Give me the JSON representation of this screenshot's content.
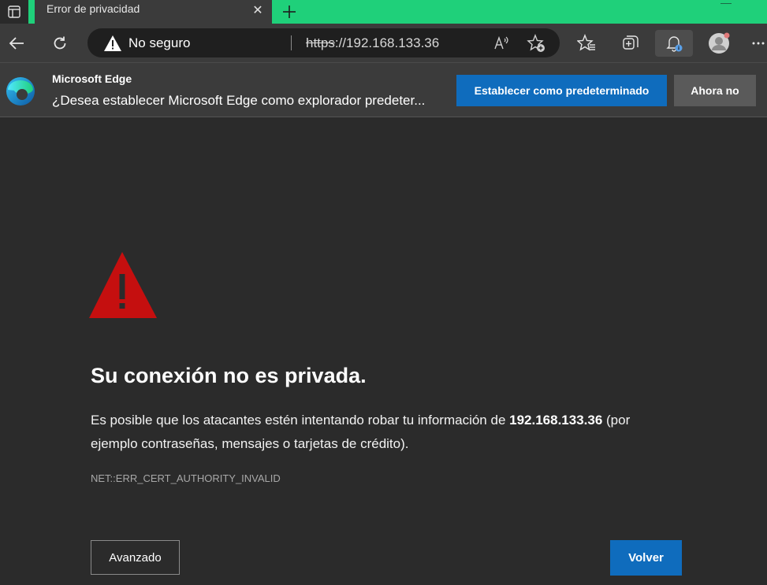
{
  "tab": {
    "title": "Error de privacidad",
    "close_glyph": "✕"
  },
  "address": {
    "security_label": "No seguro",
    "url_scheme": "https",
    "url_rest": "://192.168.133.36"
  },
  "infobar": {
    "title": "Microsoft Edge",
    "message": "¿Desea establecer Microsoft Edge como explorador predeter...",
    "primary_button": "Establecer como predeterminado",
    "secondary_button": "Ahora no"
  },
  "page": {
    "heading": "Su conexión no es privada.",
    "description_before": "Es posible que los atacantes estén intentando robar tu información de ",
    "description_host": "192.168.133.36",
    "description_after": " (por ejemplo contraseñas, mensajes o tarjetas de crédito).",
    "error_code": "NET::ERR_CERT_AUTHORITY_INVALID",
    "advanced_button": "Avanzado",
    "back_button": "Volver"
  },
  "colors": {
    "accent": "#0f6cbd",
    "tabstrip": "#1fd07a",
    "warning": "#c50f0f"
  },
  "icons": [
    "tab-actions-icon",
    "close-icon",
    "new-tab-icon",
    "back-arrow-icon",
    "refresh-icon",
    "warning-icon",
    "read-aloud-icon",
    "add-favorite-icon",
    "favorites-icon",
    "collections-icon",
    "notifications-icon",
    "profile-icon",
    "more-icon",
    "edge-logo-icon"
  ]
}
